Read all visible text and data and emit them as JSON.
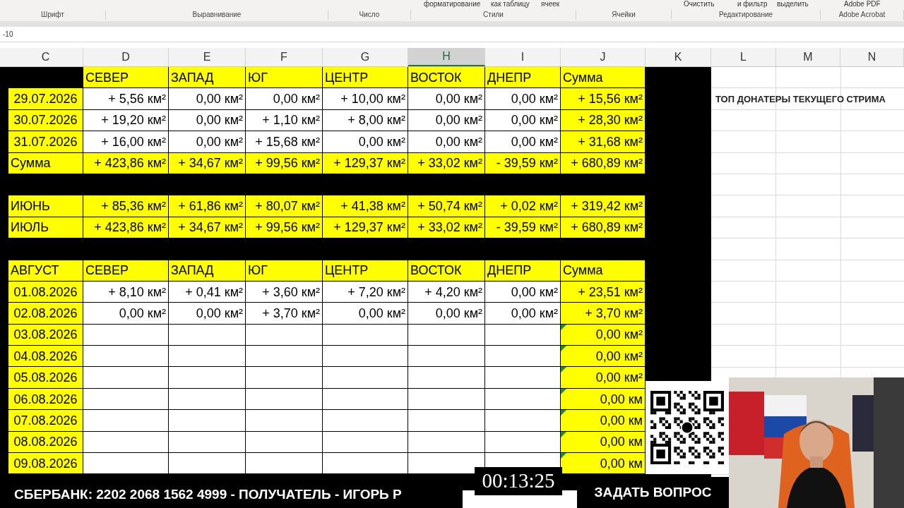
{
  "ribbon": {
    "top_labels": [
      "форматирование",
      "как таблицу",
      "ячеек",
      "Очистить",
      "и фильтр",
      "выделить",
      "Adobe PDF"
    ],
    "groups": [
      "Шрифт",
      "Выравнивание",
      "Число",
      "Стили",
      "Ячейки",
      "Редактирование",
      "Adobe Acrobat"
    ]
  },
  "formula_bar": {
    "value": "-10"
  },
  "columns": [
    {
      "label": "C",
      "selected": false
    },
    {
      "label": "D",
      "selected": false
    },
    {
      "label": "E",
      "selected": false
    },
    {
      "label": "F",
      "selected": false
    },
    {
      "label": "G",
      "selected": false
    },
    {
      "label": "H",
      "selected": true
    },
    {
      "label": "I",
      "selected": false
    },
    {
      "label": "J",
      "selected": false
    },
    {
      "label": "K",
      "selected": false
    },
    {
      "label": "L",
      "selected": false
    },
    {
      "label": "M",
      "selected": false
    },
    {
      "label": "N",
      "selected": false
    }
  ],
  "rows": [
    {
      "kind": "header",
      "cells": [
        {
          "text": "СЕВЕР",
          "highlighted": true
        },
        {
          "text": "ЗАПАД",
          "highlighted": true
        },
        {
          "text": "ЮГ",
          "highlighted": true
        },
        {
          "text": "ЦЕНТР",
          "highlighted": true
        },
        {
          "text": "ВОСТОК",
          "highlighted": true
        },
        {
          "text": "ДНЕПР",
          "highlighted": true
        },
        {
          "text": "Сумма",
          "highlighted": true
        }
      ]
    },
    {
      "kind": "data",
      "label": "29.07.2026",
      "cells": [
        {
          "text": "+ 5,56 км²",
          "highlighted": false
        },
        {
          "text": "0,00 км²",
          "highlighted": false
        },
        {
          "text": "0,00 км²",
          "highlighted": false
        },
        {
          "text": "+ 10,00 км²",
          "highlighted": false
        },
        {
          "text": "0,00 км²",
          "highlighted": false
        },
        {
          "text": "0,00 км²",
          "highlighted": false
        },
        {
          "text": "+ 15,56 км²",
          "highlighted": true
        }
      ]
    },
    {
      "kind": "data",
      "label": "30.07.2026",
      "cells": [
        {
          "text": "+ 19,20 км²",
          "highlighted": false
        },
        {
          "text": "0,00 км²",
          "highlighted": false
        },
        {
          "text": "+ 1,10 км²",
          "highlighted": false
        },
        {
          "text": "+ 8,00 км²",
          "highlighted": false
        },
        {
          "text": "0,00 км²",
          "highlighted": false
        },
        {
          "text": "0,00 км²",
          "highlighted": false
        },
        {
          "text": "+ 28,30 км²",
          "highlighted": true
        }
      ]
    },
    {
      "kind": "data",
      "label": "31.07.2026",
      "cells": [
        {
          "text": "+ 16,00 км²",
          "highlighted": false
        },
        {
          "text": "0,00 км²",
          "highlighted": false
        },
        {
          "text": "+ 15,68 км²",
          "highlighted": false
        },
        {
          "text": "0,00 км²",
          "highlighted": false
        },
        {
          "text": "0,00 км²",
          "highlighted": false
        },
        {
          "text": "0,00 км²",
          "highlighted": false
        },
        {
          "text": "+ 31,68 км²",
          "highlighted": true
        }
      ]
    },
    {
      "kind": "total",
      "label": "Сумма",
      "cells": [
        {
          "text": "+ 423,86 км²",
          "highlighted": true
        },
        {
          "text": "+ 34,67 км²",
          "highlighted": true
        },
        {
          "text": "+ 99,56 км²",
          "highlighted": true
        },
        {
          "text": "+ 129,37 км²",
          "highlighted": true
        },
        {
          "text": "+ 33,02 км²",
          "highlighted": true
        },
        {
          "text": "- 39,59 км²",
          "highlighted": true
        },
        {
          "text": "+ 680,89 км²",
          "highlighted": true
        }
      ]
    },
    {
      "kind": "gap"
    },
    {
      "kind": "total",
      "label": "ИЮНЬ",
      "cells": [
        {
          "text": "+ 85,36 км²",
          "highlighted": true
        },
        {
          "text": "+ 61,86 км²",
          "highlighted": true
        },
        {
          "text": "+ 80,07 км²",
          "highlighted": true
        },
        {
          "text": "+ 41,38 км²",
          "highlighted": true
        },
        {
          "text": "+ 50,74 км²",
          "highlighted": true
        },
        {
          "text": "+ 0,02 км²",
          "highlighted": true
        },
        {
          "text": "+ 319,42 км²",
          "highlighted": true
        }
      ]
    },
    {
      "kind": "total",
      "label": "ИЮЛЬ",
      "cells": [
        {
          "text": "+ 423,86 км²",
          "highlighted": true
        },
        {
          "text": "+ 34,67 км²",
          "highlighted": true
        },
        {
          "text": "+ 99,56 км²",
          "highlighted": true
        },
        {
          "text": "+ 129,37 км²",
          "highlighted": true
        },
        {
          "text": "+ 33,02 км²",
          "highlighted": true
        },
        {
          "text": "- 39,59 км²",
          "highlighted": true
        },
        {
          "text": "+ 680,89 км²",
          "highlighted": true
        }
      ]
    },
    {
      "kind": "gap"
    },
    {
      "kind": "header",
      "label": "АВГУСТ",
      "cells": [
        {
          "text": "СЕВЕР",
          "highlighted": true
        },
        {
          "text": "ЗАПАД",
          "highlighted": true
        },
        {
          "text": "ЮГ",
          "highlighted": true
        },
        {
          "text": "ЦЕНТР",
          "highlighted": true
        },
        {
          "text": "ВОСТОК",
          "highlighted": true
        },
        {
          "text": "ДНЕПР",
          "highlighted": true
        },
        {
          "text": "Сумма",
          "highlighted": true
        }
      ]
    },
    {
      "kind": "data",
      "label": "01.08.2026",
      "cells": [
        {
          "text": "+ 8,10 км²",
          "highlighted": false
        },
        {
          "text": "+ 0,41 км²",
          "highlighted": false
        },
        {
          "text": "+ 3,60 км²",
          "highlighted": false
        },
        {
          "text": "+ 7,20 км²",
          "highlighted": false
        },
        {
          "text": "+ 4,20 км²",
          "highlighted": false
        },
        {
          "text": "0,00 км²",
          "highlighted": false
        },
        {
          "text": "+ 23,51 км²",
          "highlighted": true
        }
      ]
    },
    {
      "kind": "data",
      "label": "02.08.2026",
      "cells": [
        {
          "text": "0,00 км²",
          "highlighted": false
        },
        {
          "text": "0,00 км²",
          "highlighted": false
        },
        {
          "text": "+ 3,70 км²",
          "highlighted": false
        },
        {
          "text": "0,00 км²",
          "highlighted": false
        },
        {
          "text": "0,00 км²",
          "highlighted": false
        },
        {
          "text": "0,00 км²",
          "highlighted": false
        },
        {
          "text": "+ 3,70 км²",
          "highlighted": true
        }
      ]
    },
    {
      "kind": "data",
      "label": "03.08.2026",
      "cells": [
        {
          "highlighted": false
        },
        {
          "highlighted": false
        },
        {
          "highlighted": false
        },
        {
          "highlighted": false
        },
        {
          "highlighted": false
        },
        {
          "highlighted": false
        },
        {
          "text": "0,00 км²",
          "highlighted": true,
          "flagged": true
        }
      ]
    },
    {
      "kind": "data",
      "label": "04.08.2026",
      "cells": [
        {
          "highlighted": false
        },
        {
          "highlighted": false
        },
        {
          "highlighted": false
        },
        {
          "highlighted": false
        },
        {
          "highlighted": false
        },
        {
          "highlighted": false
        },
        {
          "text": "0,00 км²",
          "highlighted": true,
          "flagged": true
        }
      ]
    },
    {
      "kind": "data",
      "label": "05.08.2026",
      "cells": [
        {
          "highlighted": false
        },
        {
          "highlighted": false
        },
        {
          "highlighted": false
        },
        {
          "highlighted": false
        },
        {
          "highlighted": false
        },
        {
          "highlighted": false
        },
        {
          "text": "0,00 км²",
          "highlighted": true,
          "flagged": true
        }
      ]
    },
    {
      "kind": "data",
      "label": "06.08.2026",
      "cells": [
        {
          "highlighted": false
        },
        {
          "highlighted": false
        },
        {
          "highlighted": false
        },
        {
          "highlighted": false
        },
        {
          "highlighted": false
        },
        {
          "highlighted": false
        },
        {
          "text": "0,00 км",
          "highlighted": true,
          "flagged": true
        }
      ]
    },
    {
      "kind": "data",
      "label": "07.08.2026",
      "cells": [
        {
          "highlighted": false
        },
        {
          "highlighted": false
        },
        {
          "highlighted": false
        },
        {
          "highlighted": false
        },
        {
          "highlighted": false
        },
        {
          "highlighted": false
        },
        {
          "text": "0,00 км",
          "highlighted": true,
          "flagged": true
        }
      ]
    },
    {
      "kind": "data",
      "label": "08.08.2026",
      "cells": [
        {
          "highlighted": false
        },
        {
          "highlighted": false
        },
        {
          "highlighted": false
        },
        {
          "highlighted": false
        },
        {
          "highlighted": false
        },
        {
          "highlighted": false
        },
        {
          "text": "0,00 км",
          "highlighted": true,
          "flagged": true
        }
      ]
    },
    {
      "kind": "data",
      "label": "09.08.2026",
      "cells": [
        {
          "highlighted": false
        },
        {
          "highlighted": false
        },
        {
          "highlighted": false
        },
        {
          "highlighted": false
        },
        {
          "highlighted": false
        },
        {
          "highlighted": false
        },
        {
          "text": "0,00 км",
          "highlighted": true,
          "flagged": true
        }
      ]
    }
  ],
  "donors_title": "ТОП ДОНАТЕРЫ ТЕКУЩЕГО СТРИМА",
  "overlay": {
    "bank_banner": "СБЕРБАНК: 2202 2068 1562 4999 - ПОЛУЧАТЕЛЬ - ИГОРЬ Р",
    "timer": "00:13:25",
    "ask_button": "ЗАДАТЬ ВОПРОС"
  }
}
